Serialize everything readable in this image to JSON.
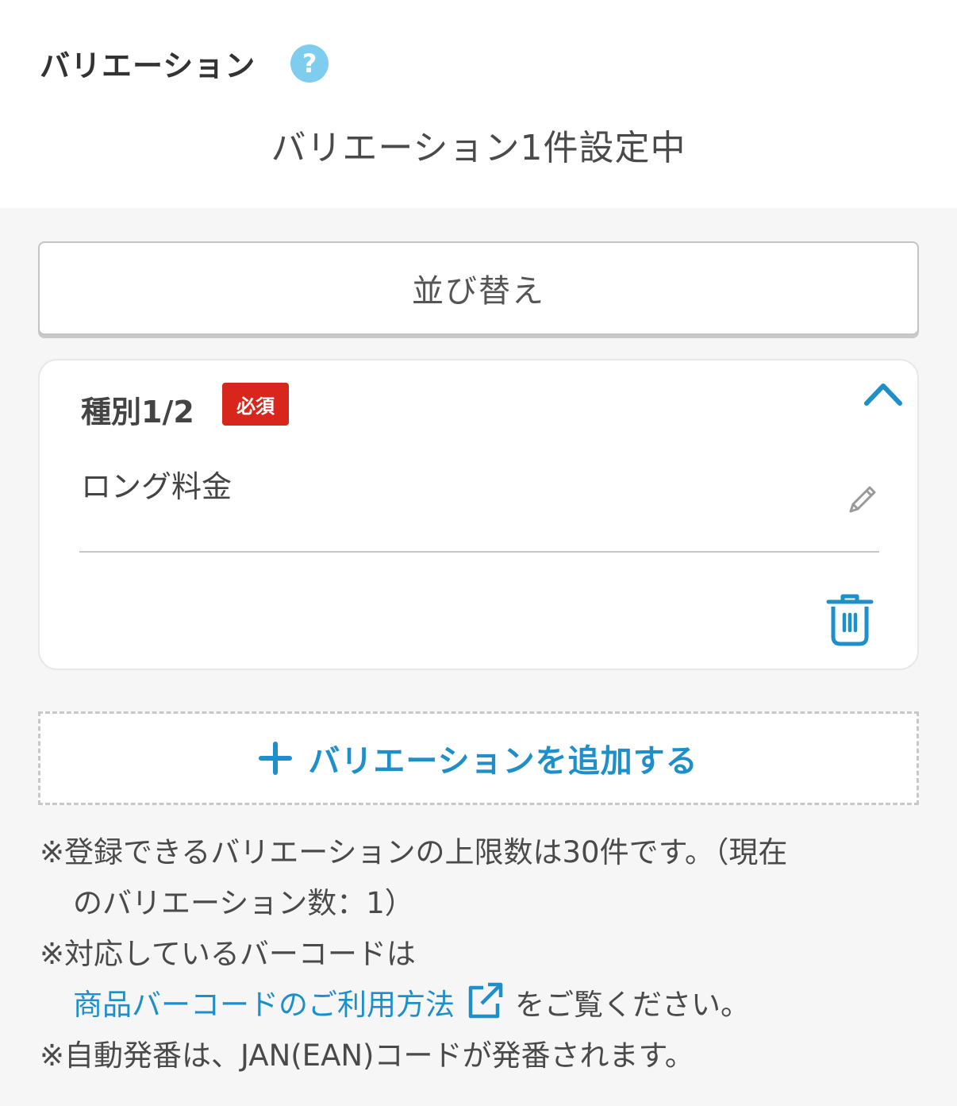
{
  "header": {
    "title": "バリエーション",
    "help_icon": "?",
    "status": "バリエーション1件設定中"
  },
  "sort_button": {
    "label": "並び替え"
  },
  "card": {
    "label": "種別1/2",
    "required_badge": "必須",
    "value": "ロング料金",
    "icons": [
      "chevron-up-icon",
      "pencil-icon",
      "trash-icon"
    ]
  },
  "add_button": {
    "label": "バリエーションを追加する"
  },
  "notes": {
    "line1": "※登録できるバリエーションの上限数は30件です。（現在",
    "line1b": "のバリエーション数：1）",
    "line2": "※対応しているバーコードは",
    "link": "商品バーコードのご利用方法",
    "line2b": "をご覧ください。",
    "line3": "※自動発番は、JAN(EAN)コードが発番されます。"
  },
  "colors": {
    "accent": "#1e8fc9",
    "required": "#d9261c",
    "help": "#7fcdee",
    "background_gray": "#f6f6f6"
  }
}
